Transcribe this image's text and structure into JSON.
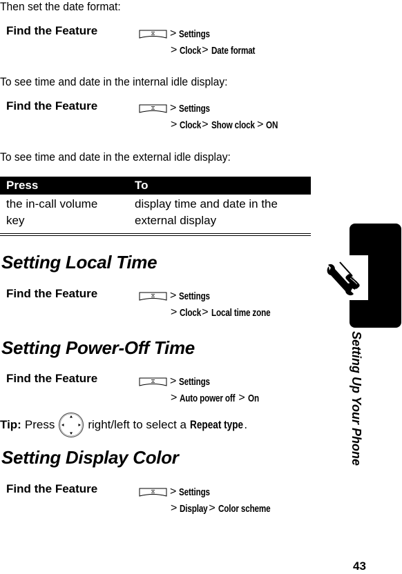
{
  "intro": {
    "date_format": "Then set the date format:",
    "internal_idle": "To see time and date in the internal idle display:",
    "external_idle": "To see time and date in the external idle display:"
  },
  "find_feature_label": "Find the Feature",
  "menu_key_icon": "menu-key-icon",
  "separator": ">",
  "paths": {
    "date_format": {
      "line1": [
        "Settings"
      ],
      "line2": [
        "Clock",
        "Date format"
      ]
    },
    "show_clock": {
      "line1": [
        "Settings"
      ],
      "line2": [
        "Clock",
        "Show clock",
        "ON"
      ]
    },
    "local_time": {
      "line1": [
        "Settings"
      ],
      "line2": [
        "Clock",
        "Local time zone"
      ]
    },
    "power_off": {
      "line1": [
        "Settings"
      ],
      "line2": [
        "Auto power off",
        "On"
      ]
    },
    "display_color": {
      "line1": [
        "Settings"
      ],
      "line2": [
        "Display",
        "Color scheme"
      ]
    }
  },
  "table": {
    "headers": [
      "Press",
      "To"
    ],
    "rows": [
      {
        "press": "the in-call volume key",
        "press_l1": "the in-call volume",
        "press_l2": "key",
        "to": "display time and date in the external display",
        "to_l1": "display time and date in the",
        "to_l2": "external display"
      }
    ]
  },
  "sections": {
    "local_time": "Setting Local Time",
    "power_off": "Setting Power-Off Time",
    "display_color": "Setting Display Color"
  },
  "tip": {
    "label": "Tip:",
    "press": "Press",
    "icon": "nav-key-icon",
    "rest": "right/left to select a",
    "option": "Repeat type",
    "end": "."
  },
  "side_tab": {
    "icon": "tools-icon",
    "title": "Setting Up Your Phone"
  },
  "page_number": "43"
}
